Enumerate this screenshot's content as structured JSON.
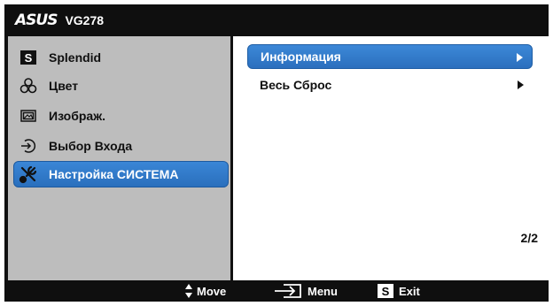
{
  "header": {
    "brand": "ASUS",
    "model": "VG278"
  },
  "left_menu": [
    {
      "label": "Splendid",
      "icon": "splendid-s-icon",
      "selected": false
    },
    {
      "label": "Цвет",
      "icon": "color-icon",
      "selected": false
    },
    {
      "label": "Изображ.",
      "icon": "image-icon",
      "selected": false
    },
    {
      "label": "Выбор Входа",
      "icon": "input-select-icon",
      "selected": false
    },
    {
      "label": "Настройка СИСТЕМА",
      "icon": "system-setup-icon",
      "selected": true
    }
  ],
  "right_menu": [
    {
      "label": "Информация",
      "selected": true
    },
    {
      "label": "Весь Сброс",
      "selected": false
    }
  ],
  "page_indicator": "2/2",
  "bottom_bar": {
    "move_label": "Move",
    "menu_label": "Menu",
    "exit_label": "Exit",
    "exit_key": "S"
  },
  "colors": {
    "selection": "#2f7acb",
    "left_panel": "#bdbdbd",
    "bars": "#0f0f0f"
  }
}
